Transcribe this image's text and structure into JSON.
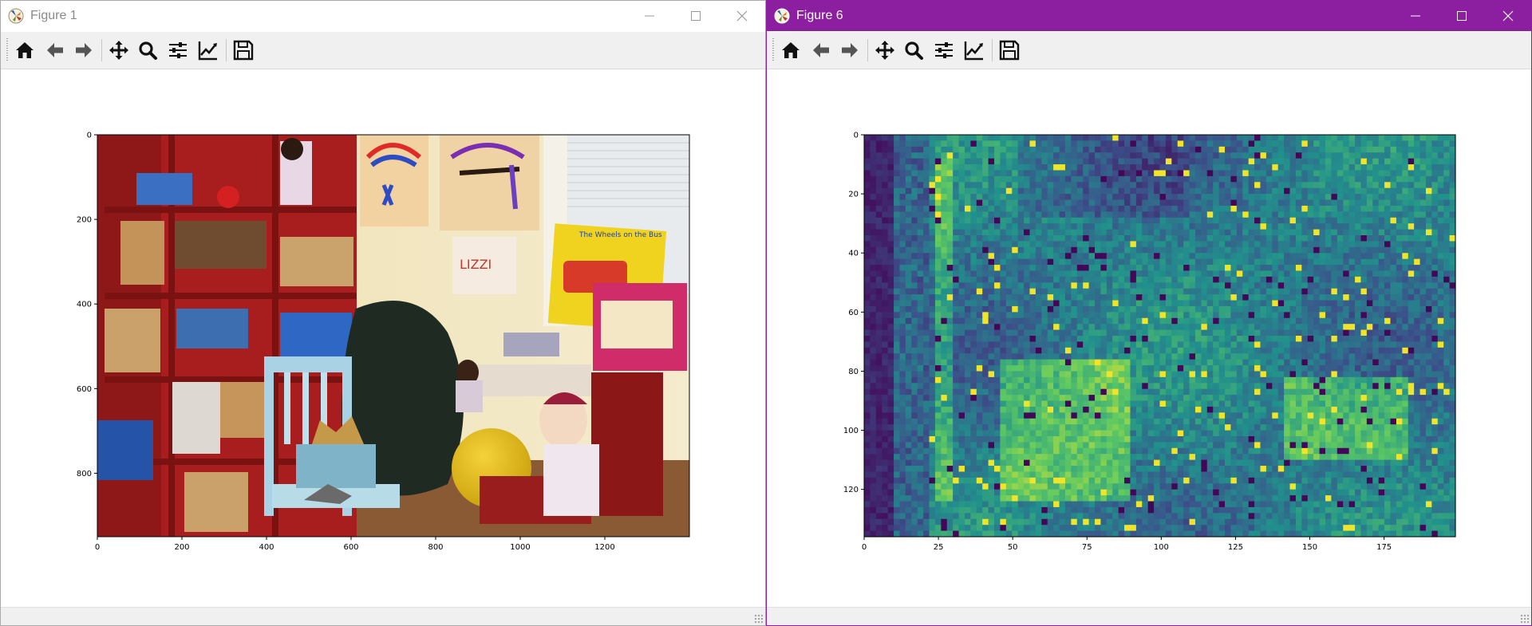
{
  "windows": [
    {
      "id": "win1",
      "title": "Figure 1",
      "toolbar_icons": [
        "home-icon",
        "back-arrow-icon",
        "forward-arrow-icon",
        "pan-icon",
        "zoom-icon",
        "configure-subplots-icon",
        "edit-axes-icon",
        "save-icon"
      ],
      "chart_data": {
        "type": "image",
        "xlim": [
          0,
          1400
        ],
        "ylim": [
          950,
          0
        ],
        "xticks": [
          "0",
          "200",
          "400",
          "600",
          "800",
          "1000",
          "1200"
        ],
        "yticks": [
          "0",
          "200",
          "400",
          "600",
          "800"
        ],
        "image_content": "Photo of a children's playroom: red bookshelf with toys and baskets, light blue chair with toy dinosaurs, dolls, yellow exercise ball, black beanbag, children's drawings and a poster on the wall",
        "poster_text": "The Wheels on the Bus"
      }
    },
    {
      "id": "win2",
      "title": "Figure 6",
      "toolbar_icons": [
        "home-icon",
        "back-arrow-icon",
        "forward-arrow-icon",
        "pan-icon",
        "zoom-icon",
        "configure-subplots-icon",
        "edit-axes-icon",
        "save-icon"
      ],
      "chart_data": {
        "type": "heatmap",
        "colormap": "viridis",
        "xlim": [
          0,
          199
        ],
        "ylim": [
          136,
          0
        ],
        "xticks": [
          "0",
          "25",
          "50",
          "75",
          "100",
          "125",
          "150",
          "175"
        ],
        "yticks": [
          "0",
          "20",
          "40",
          "60",
          "80",
          "100",
          "120"
        ]
      }
    }
  ],
  "colors": {
    "win2_accent": "#8b1fa0",
    "toolbar_bg": "#f0f0f0"
  }
}
